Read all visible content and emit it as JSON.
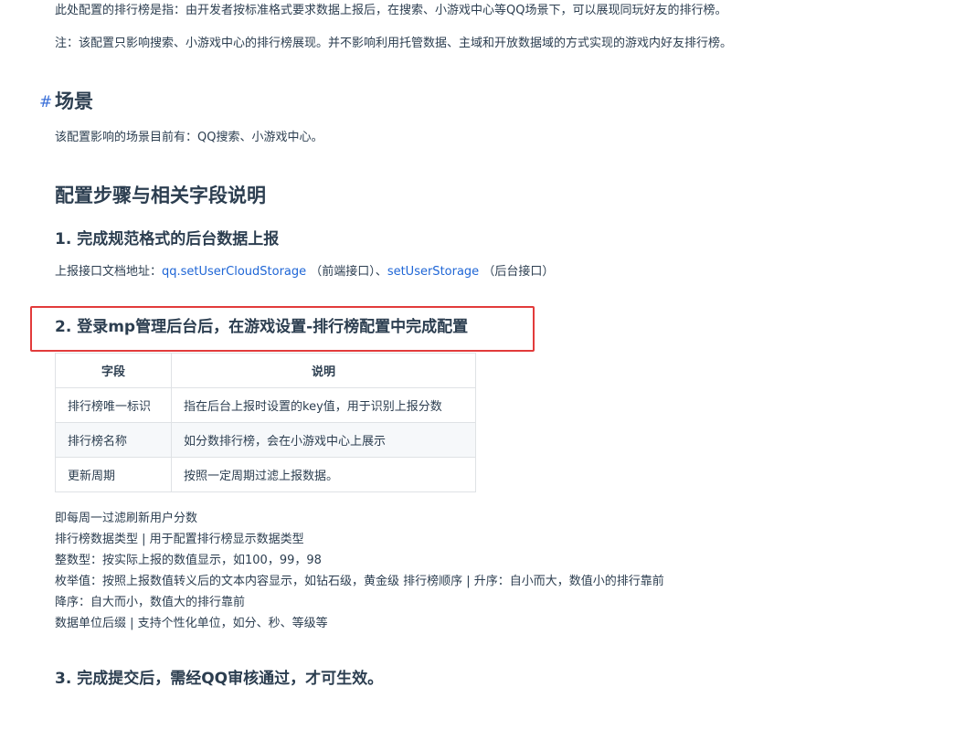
{
  "intro": {
    "line1": "此处配置的排行榜是指：由开发者按标准格式要求数据上报后，在搜索、小游戏中心等QQ场景下，可以展现同玩好友的排行榜。",
    "line2": "注：该配置只影响搜索、小游戏中心的排行榜展现。并不影响利用托管数据、主域和开放数据域的方式实现的游戏内好友排行榜。"
  },
  "scene": {
    "anchor": "#",
    "title": "场景",
    "text": "该配置影响的场景目前有：QQ搜索、小游戏中心。"
  },
  "steps": {
    "title": "配置步骤与相关字段说明",
    "step1": {
      "title": "1. 完成规范格式的后台数据上报",
      "prefix": "上报接口文档地址：",
      "link1": "qq.setUserCloudStorage",
      "mid": "（前端接口）、",
      "link2": "setUserStorage",
      "suffix": "（后台接口）"
    },
    "step2": {
      "title": "2. 登录mp管理后台后，在游戏设置-排行榜配置中完成配置"
    },
    "table": {
      "headers": [
        "字段",
        "说明"
      ],
      "rows": [
        [
          "排行榜唯一标识",
          "指在后台上报时设置的key值，用于识别上报分数"
        ],
        [
          "排行榜名称",
          "如分数排行榜，会在小游戏中心上展示"
        ],
        [
          "更新周期",
          "按照一定周期过滤上报数据。"
        ]
      ]
    },
    "notes": [
      "即每周一过滤刷新用户分数",
      "排行榜数据类型 | 用于配置排行榜显示数据类型",
      "整数型：按实际上报的数值显示，如100，99，98",
      "枚举值：按照上报数值转义后的文本内容显示，如钻石级，黄金级 排行榜顺序 | 升序：自小而大，数值小的排行靠前",
      "降序：自大而小，数值大的排行靠前",
      "数据单位后缀 | 支持个性化单位，如分、秒、等级等"
    ],
    "step3": {
      "title": "3. 完成提交后，需经QQ审核通过，才可生效。"
    }
  }
}
